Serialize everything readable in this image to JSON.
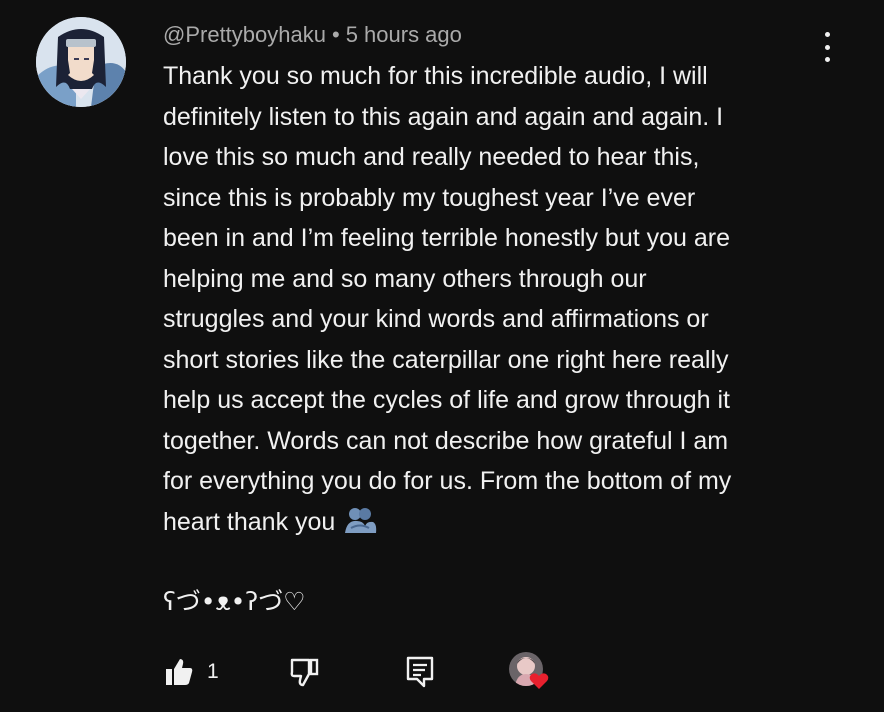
{
  "comment": {
    "author": "@Prettyboyhaku",
    "separator": "•",
    "timestamp": "5 hours ago",
    "body_lines": [
      "Thank you so much for this incredible audio, I will",
      "definitely listen to this again and again and again. I",
      "love this so much and really needed to hear this,",
      "since this is probably my toughest year I’ve ever",
      "been in and I’m feeling terrible honestly but you are",
      "helping me and so many others through our",
      "struggles and your kind words and affirmations or",
      "short stories like the caterpillar one right here really",
      "help us accept the cycles of life and grow through it",
      "together. Words can not describe how grateful I am",
      "for everything you do for us. From the bottom of my",
      "heart thank you"
    ],
    "kaomoji": "ʕづ•ᴥ•ʔづ♡",
    "trailing_emoji": "people-hugging-icon"
  },
  "actions": {
    "like_count": "1",
    "like_icon": "thumbs-up-filled-icon",
    "dislike_icon": "thumbs-down-icon",
    "reply_icon": "reply-comment-icon",
    "creator_heart_icon": "creator-heart-icon"
  },
  "colors": {
    "background": "#0f0f0f",
    "text": "#f1f1f1",
    "meta": "#aaaaaa",
    "heart": "#e8202e",
    "hug_emoji": "#6f8fb6"
  }
}
